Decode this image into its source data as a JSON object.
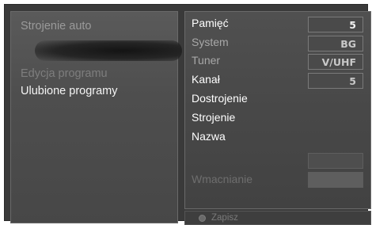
{
  "left_menu": {
    "items": [
      {
        "label": "Strojenie auto"
      },
      {
        "label": "Edycja programu"
      },
      {
        "label": "Ulubione programy"
      }
    ]
  },
  "right_menu": {
    "rows": [
      {
        "label": "Pamięć",
        "value": "5"
      },
      {
        "label": "System",
        "value": "BG"
      },
      {
        "label": "Tuner",
        "value": "V/UHF"
      },
      {
        "label": "Kanał",
        "value": "5"
      },
      {
        "label": "Dostrojenie"
      },
      {
        "label": "Strojenie"
      },
      {
        "label": "Nazwa"
      },
      {
        "label": "Wmacnianie"
      }
    ]
  },
  "footer": {
    "save_label": "Zapisz",
    "save_icon": "circle-button-icon"
  }
}
